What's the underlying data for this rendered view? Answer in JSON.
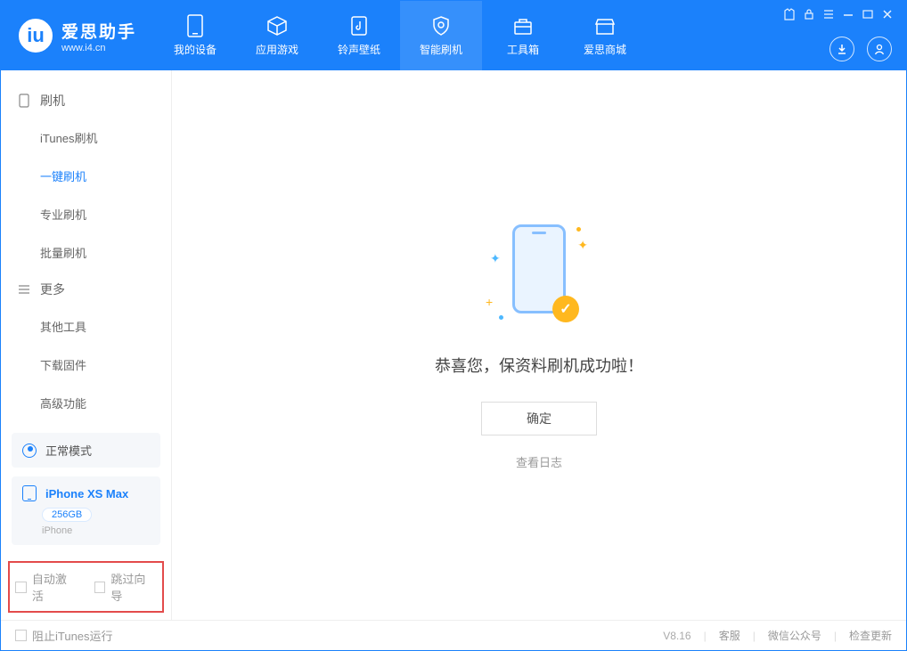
{
  "brand": {
    "title": "爱思助手",
    "subtitle": "www.i4.cn"
  },
  "tabs": [
    {
      "label": "我的设备"
    },
    {
      "label": "应用游戏"
    },
    {
      "label": "铃声壁纸"
    },
    {
      "label": "智能刷机"
    },
    {
      "label": "工具箱"
    },
    {
      "label": "爱思商城"
    }
  ],
  "sidebar": {
    "group1": "刷机",
    "items1": [
      "iTunes刷机",
      "一键刷机",
      "专业刷机",
      "批量刷机"
    ],
    "group2": "更多",
    "items2": [
      "其他工具",
      "下载固件",
      "高级功能"
    ]
  },
  "mode": {
    "label": "正常模式"
  },
  "device": {
    "name": "iPhone XS Max",
    "storage": "256GB",
    "type": "iPhone"
  },
  "checks": {
    "auto_activate": "自动激活",
    "skip_guide": "跳过向导"
  },
  "main": {
    "success": "恭喜您，保资料刷机成功啦！",
    "ok": "确定",
    "view_log": "查看日志"
  },
  "footer": {
    "block_itunes": "阻止iTunes运行",
    "version": "V8.16",
    "support": "客服",
    "wechat": "微信公众号",
    "update": "检查更新"
  }
}
